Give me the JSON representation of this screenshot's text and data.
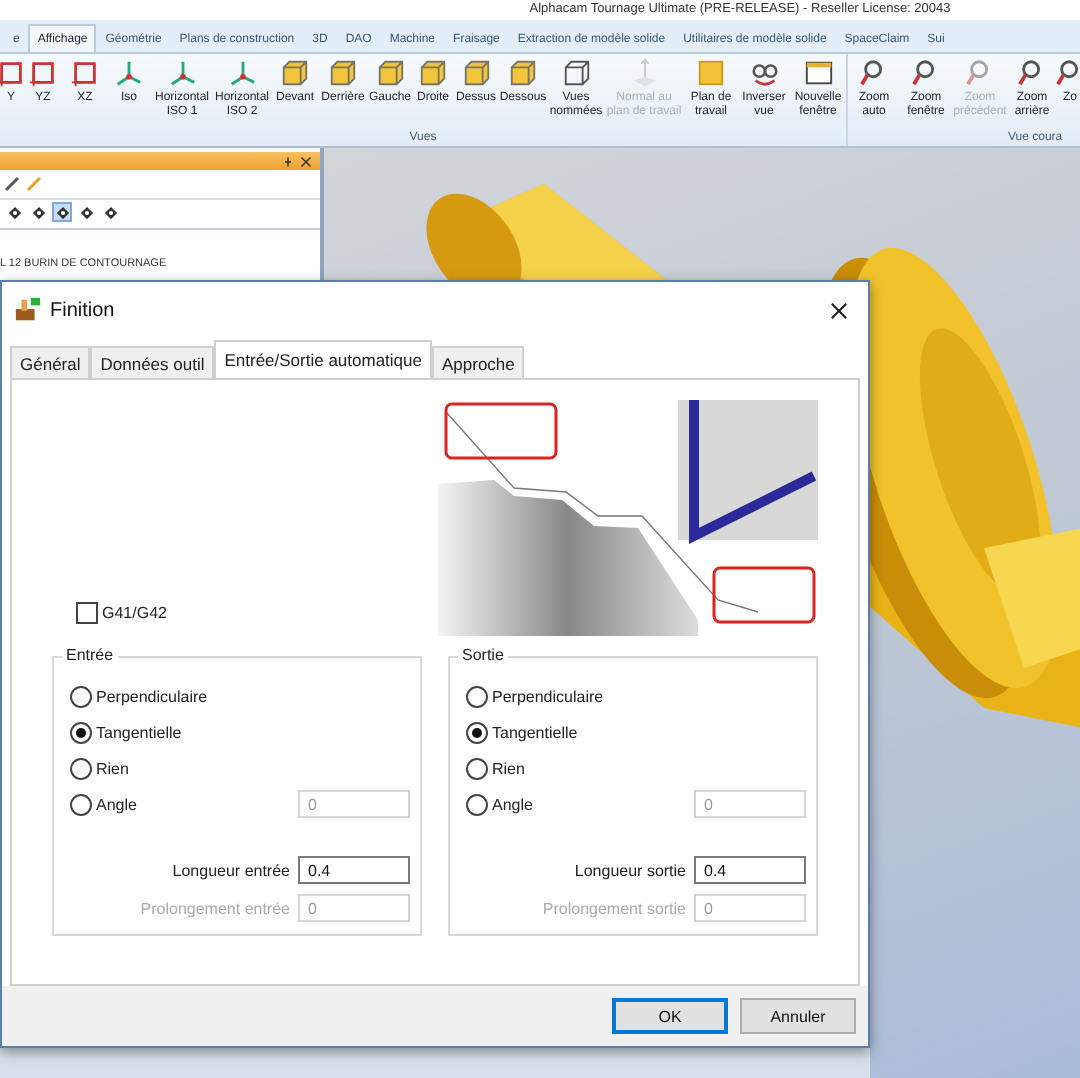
{
  "window": {
    "title": "Alphacam Tournage Ultimate (PRE-RELEASE) - Reseller License: 20043"
  },
  "ribbon_tabs": [
    {
      "label": "e",
      "selected": false
    },
    {
      "label": "Affichage",
      "selected": true
    },
    {
      "label": "Géométrie",
      "selected": false
    },
    {
      "label": "Plans de construction",
      "selected": false
    },
    {
      "label": "3D",
      "selected": false
    },
    {
      "label": "DAO",
      "selected": false
    },
    {
      "label": "Machine",
      "selected": false
    },
    {
      "label": "Fraisage",
      "selected": false
    },
    {
      "label": "Extraction de modèle solide",
      "selected": false
    },
    {
      "label": "Utilitaires de modèle solide",
      "selected": false
    },
    {
      "label": "SpaceClaim",
      "selected": false
    },
    {
      "label": "Sui",
      "selected": false
    }
  ],
  "ribbon_groups": [
    {
      "label": "Vues",
      "buttons": [
        {
          "label": "Y",
          "kind": "frame",
          "disabled": false
        },
        {
          "label": "YZ",
          "kind": "frame",
          "disabled": false
        },
        {
          "label": "XZ",
          "kind": "frame",
          "disabled": false
        },
        {
          "label": "Iso",
          "kind": "axes",
          "disabled": false
        },
        {
          "label": "Horizontal ISO 1",
          "kind": "axes",
          "disabled": false
        },
        {
          "label": "Horizontal ISO 2",
          "kind": "axes",
          "disabled": false
        },
        {
          "label": "Devant",
          "kind": "cube",
          "disabled": false
        },
        {
          "label": "Derrière",
          "kind": "cube",
          "disabled": false
        },
        {
          "label": "Gauche",
          "kind": "cube",
          "disabled": false
        },
        {
          "label": "Droite",
          "kind": "cube",
          "disabled": false
        },
        {
          "label": "Dessus",
          "kind": "cube",
          "disabled": false
        },
        {
          "label": "Dessous",
          "kind": "cube",
          "disabled": false
        },
        {
          "label": "Vues nommées",
          "kind": "wire",
          "disabled": false
        },
        {
          "label": "Normal au plan de travail",
          "kind": "normal",
          "disabled": true
        },
        {
          "label": "Plan de travail",
          "kind": "plane",
          "disabled": false
        },
        {
          "label": "Inverser vue",
          "kind": "glasses",
          "disabled": false
        },
        {
          "label": "Nouvelle fenêtre",
          "kind": "window",
          "disabled": false
        }
      ]
    },
    {
      "label": "Vue coura",
      "buttons": [
        {
          "label": "Zoom auto",
          "kind": "zoom",
          "disabled": false
        },
        {
          "label": "Zoom fenêtre",
          "kind": "zoom",
          "disabled": false
        },
        {
          "label": "Zoom précédent",
          "kind": "zoom",
          "disabled": true
        },
        {
          "label": "Zoom arrière",
          "kind": "zoom",
          "disabled": false
        },
        {
          "label": "Zo",
          "kind": "zoom",
          "disabled": false
        }
      ]
    }
  ],
  "tool_panel": {
    "tools": [
      {
        "selected": false
      },
      {
        "selected": false
      },
      {
        "selected": true
      },
      {
        "selected": false
      },
      {
        "selected": false
      }
    ],
    "items": [
      "L 12 BURIN DE CONTOURNAGE"
    ]
  },
  "dialog": {
    "title": "Finition",
    "tabs": [
      {
        "label": "Général",
        "selected": false
      },
      {
        "label": "Données outil",
        "selected": false
      },
      {
        "label": "Entrée/Sortie automatique",
        "selected": true
      },
      {
        "label": "Approche",
        "selected": false
      }
    ],
    "g41_g42": {
      "label": "G41/G42",
      "checked": false
    },
    "groups": [
      {
        "legend": "Entrée",
        "options": [
          {
            "label": "Perpendiculaire",
            "selected": false
          },
          {
            "label": "Tangentielle",
            "selected": true
          },
          {
            "label": "Rien",
            "selected": false
          },
          {
            "label": "Angle",
            "selected": false
          }
        ],
        "angle": {
          "value": "0",
          "disabled": true
        },
        "fields": [
          {
            "label": "Longueur entrée",
            "value": "0.4",
            "disabled": false
          },
          {
            "label": "Prolongement entrée",
            "value": "0",
            "disabled": true
          }
        ]
      },
      {
        "legend": "Sortie",
        "options": [
          {
            "label": "Perpendiculaire",
            "selected": false
          },
          {
            "label": "Tangentielle",
            "selected": true
          },
          {
            "label": "Rien",
            "selected": false
          },
          {
            "label": "Angle",
            "selected": false
          }
        ],
        "angle": {
          "value": "0",
          "disabled": true
        },
        "fields": [
          {
            "label": "Longueur sortie",
            "value": "0.4",
            "disabled": false
          },
          {
            "label": "Prolongement sortie",
            "value": "0",
            "disabled": true
          }
        ]
      }
    ],
    "buttons": [
      {
        "label": "OK",
        "default": true
      },
      {
        "label": "Annuler",
        "default": false
      }
    ]
  }
}
